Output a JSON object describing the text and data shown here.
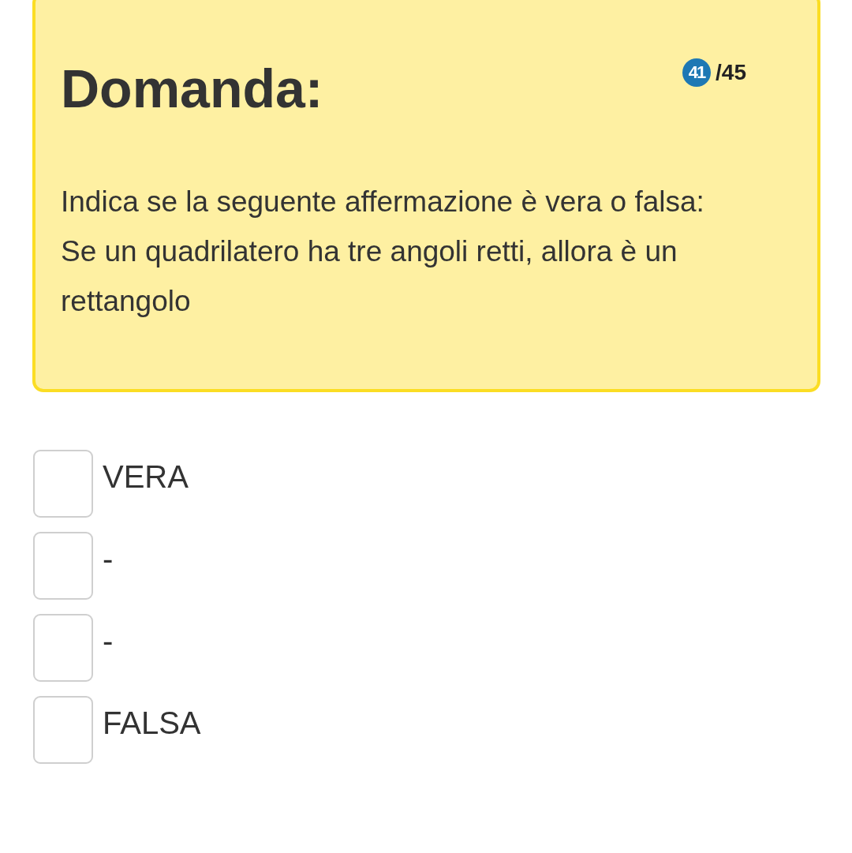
{
  "question": {
    "title": "Domanda:",
    "number": "41",
    "total": "/45",
    "paragraphs": [
      "Indica se la seguente affermazione è vera o falsa:",
      "Se un quadrilatero ha tre angoli retti, allora è un rettangolo"
    ]
  },
  "options": [
    {
      "label": "VERA",
      "checked": false
    },
    {
      "label": "-",
      "checked": false
    },
    {
      "label": "-",
      "checked": false
    },
    {
      "label": "FALSA",
      "checked": false
    }
  ]
}
